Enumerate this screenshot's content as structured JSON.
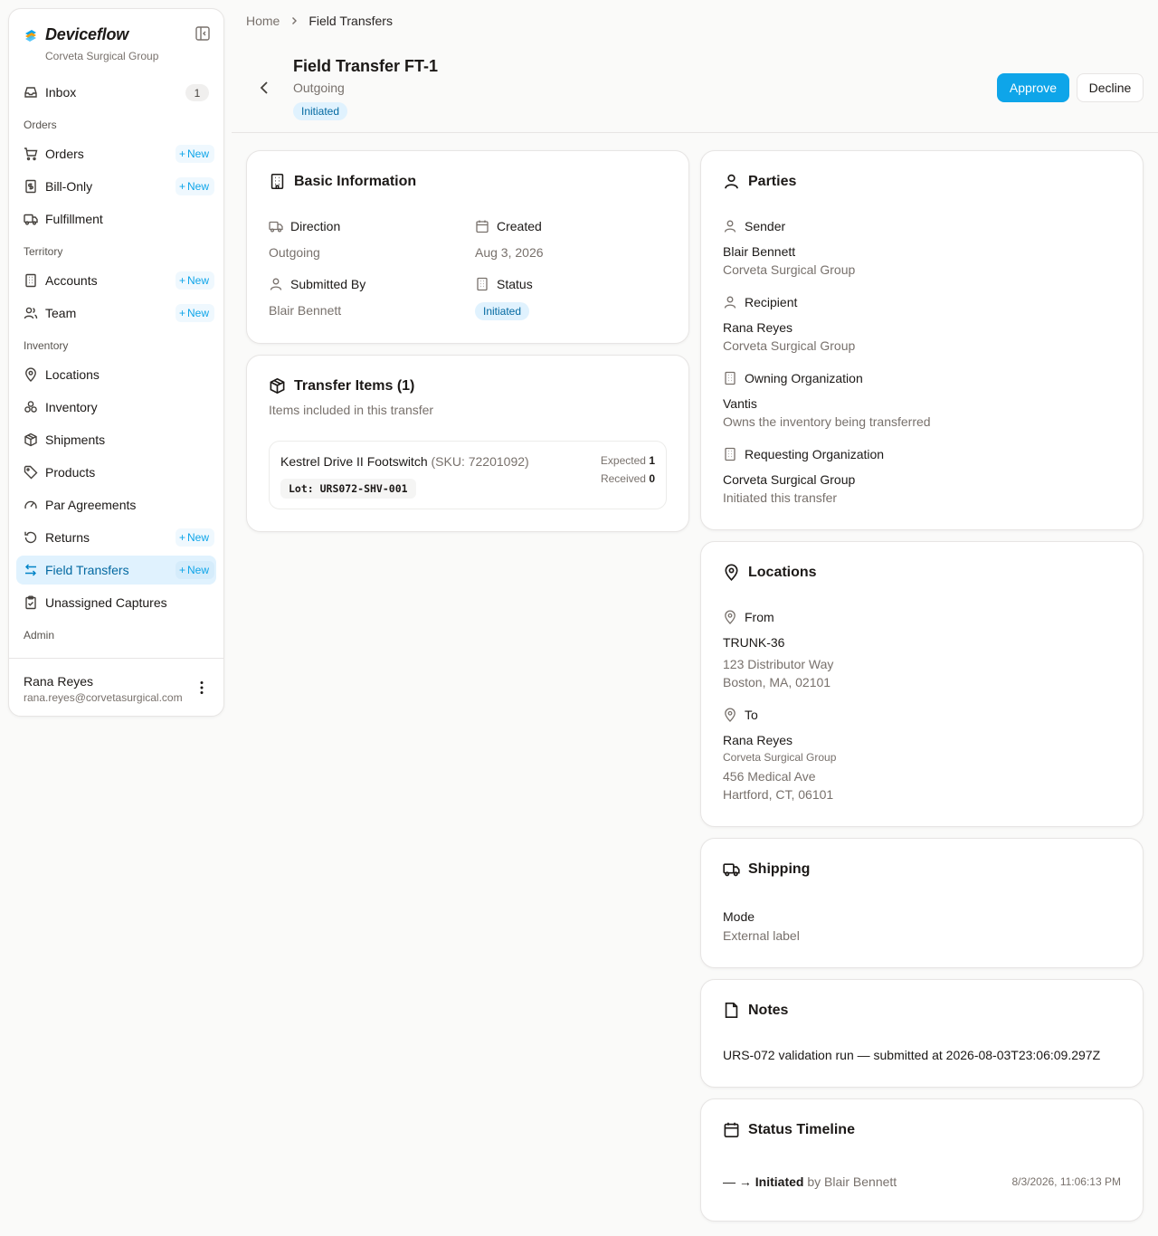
{
  "app": {
    "name": "Deviceflow",
    "org": "Corveta Surgical Group"
  },
  "sidebar": {
    "inbox": {
      "label": "Inbox",
      "count": "1"
    },
    "sections": {
      "orders": "Orders",
      "territory": "Territory",
      "inventory": "Inventory",
      "admin": "Admin"
    },
    "new_label": "New",
    "items": {
      "orders": "Orders",
      "bill_only": "Bill-Only",
      "fulfillment": "Fulfillment",
      "accounts": "Accounts",
      "team": "Team",
      "locations": "Locations",
      "inventory": "Inventory",
      "shipments": "Shipments",
      "products": "Products",
      "par_agreements": "Par Agreements",
      "returns": "Returns",
      "field_transfers": "Field Transfers",
      "unassigned_captures": "Unassigned Captures"
    },
    "user": {
      "name": "Rana Reyes",
      "email": "rana.reyes@corvetasurgical.com"
    }
  },
  "breadcrumb": [
    "Home",
    "Field Transfers"
  ],
  "header": {
    "title": "Field Transfer FT-1",
    "subtitle": "Outgoing",
    "status": "Initiated",
    "approve": "Approve",
    "decline": "Decline"
  },
  "basic_info": {
    "title": "Basic Information",
    "direction_label": "Direction",
    "direction": "Outgoing",
    "created_label": "Created",
    "created": "Aug 3, 2026",
    "submitted_label": "Submitted By",
    "submitted_by": "Blair Bennett",
    "status_label": "Status",
    "status": "Initiated"
  },
  "transfer_items": {
    "title": "Transfer Items (1)",
    "subtitle": "Items included in this transfer",
    "items": [
      {
        "name": "Kestrel Drive II Footswitch",
        "sku": "(SKU: 72201092)",
        "lot": "Lot: URS072-SHV-001",
        "expected_label": "Expected",
        "expected": "1",
        "received_label": "Received",
        "received": "0"
      }
    ]
  },
  "parties": {
    "title": "Parties",
    "sender_label": "Sender",
    "sender_name": "Blair Bennett",
    "sender_org": "Corveta Surgical Group",
    "recipient_label": "Recipient",
    "recipient_name": "Rana Reyes",
    "recipient_org": "Corveta Surgical Group",
    "owning_label": "Owning Organization",
    "owning_name": "Vantis",
    "owning_note": "Owns the inventory being transferred",
    "requesting_label": "Requesting Organization",
    "requesting_name": "Corveta Surgical Group",
    "requesting_note": "Initiated this transfer"
  },
  "locations": {
    "title": "Locations",
    "from_label": "From",
    "from_name": "TRUNK-36",
    "from_addr1": "123 Distributor Way",
    "from_addr2": "Boston, MA, 02101",
    "to_label": "To",
    "to_name": "Rana Reyes",
    "to_org": "Corveta Surgical Group",
    "to_addr1": "456 Medical Ave",
    "to_addr2": "Hartford, CT, 06101"
  },
  "shipping": {
    "title": "Shipping",
    "mode_label": "Mode",
    "mode": "External label"
  },
  "notes": {
    "title": "Notes",
    "text": "URS-072 validation run — submitted at 2026-08-03T23:06:09.297Z"
  },
  "timeline": {
    "title": "Status Timeline",
    "entries": [
      {
        "arrow": "— →",
        "status": "Initiated",
        "by": "by Blair Bennett",
        "time": "8/3/2026, 11:06:13 PM"
      }
    ]
  },
  "colors": {
    "accent": "#0ea5e9",
    "active_bg": "#e0f2fe",
    "background": "#fafaf9"
  }
}
